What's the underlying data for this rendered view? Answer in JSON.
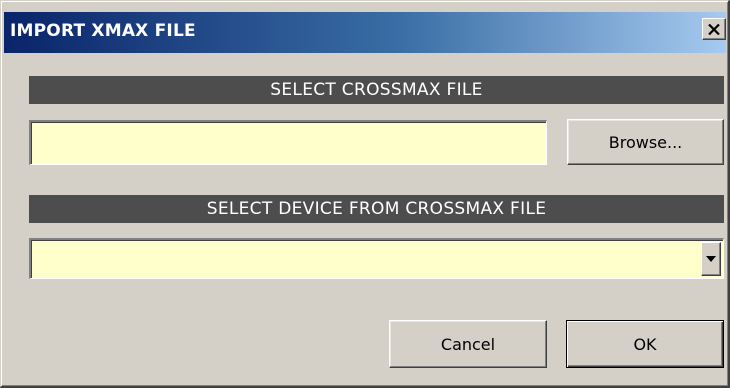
{
  "window": {
    "title": "IMPORT XMAX FILE",
    "close_icon": "close-x-icon"
  },
  "file_section": {
    "header": "SELECT CROSSMAX FILE",
    "file_path_value": "",
    "browse_label": "Browse..."
  },
  "device_section": {
    "header": "SELECT DEVICE FROM CROSSMAX FILE",
    "selected_device": "",
    "dropdown_icon": "chevron-down-icon"
  },
  "footer": {
    "cancel_label": "Cancel",
    "ok_label": "OK"
  },
  "colors": {
    "dialog_background": "#d4d0c8",
    "titlebar_start": "#0a246a",
    "titlebar_end": "#a6caf0",
    "section_header_background": "#4d4d4d",
    "field_background": "#ffffcc"
  }
}
